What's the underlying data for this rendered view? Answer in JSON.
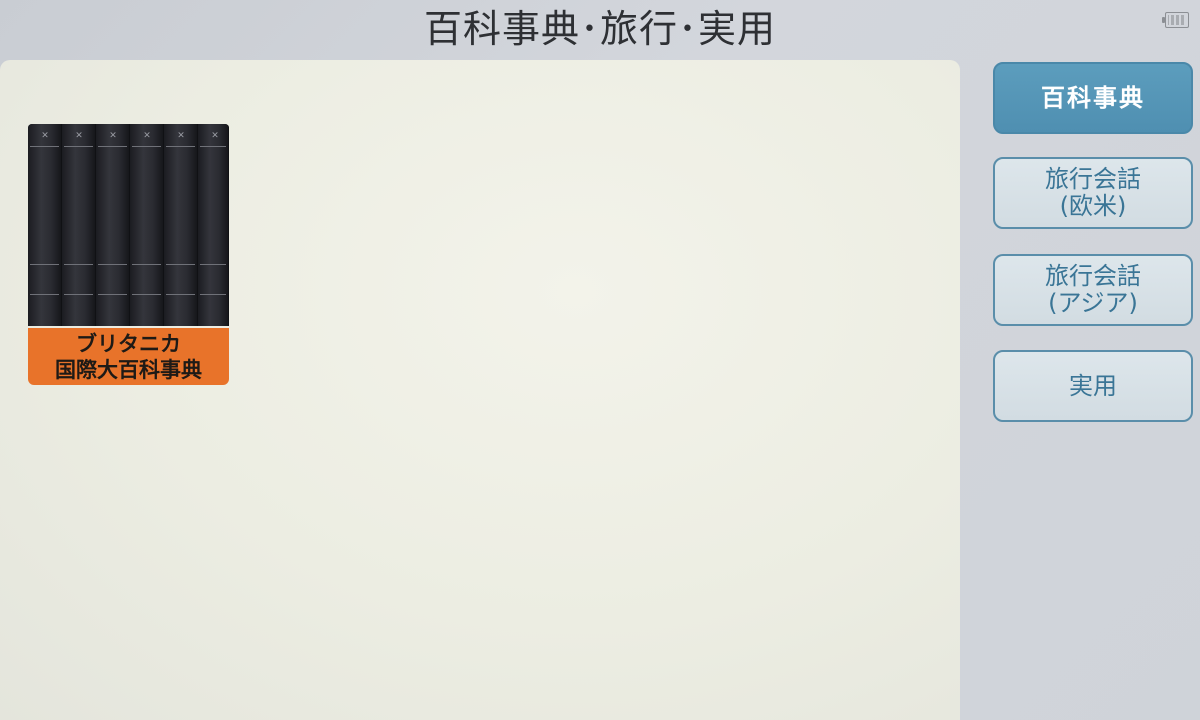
{
  "header": {
    "title": "百科事典･旅行･実用"
  },
  "status": {
    "battery_icon": "battery-icon"
  },
  "content": {
    "books": [
      {
        "label_line1": "ブリタニカ",
        "label_line2": "国際大百科事典",
        "label_color": "#e8732a",
        "icon": "book-set-image"
      }
    ]
  },
  "sidebar": {
    "buttons": [
      {
        "line1": "百科事典",
        "line2": "",
        "active": true
      },
      {
        "line1": "旅行会話",
        "line2": "(欧米)",
        "active": false
      },
      {
        "line1": "旅行会話",
        "line2": "(アジア)",
        "active": false
      },
      {
        "line1": "実用",
        "line2": "",
        "active": false
      }
    ]
  },
  "colors": {
    "active_button": "#5c9dbd",
    "button_border": "#5a8eaa",
    "button_text": "#3a7596",
    "panel_background": "#ecede2"
  }
}
